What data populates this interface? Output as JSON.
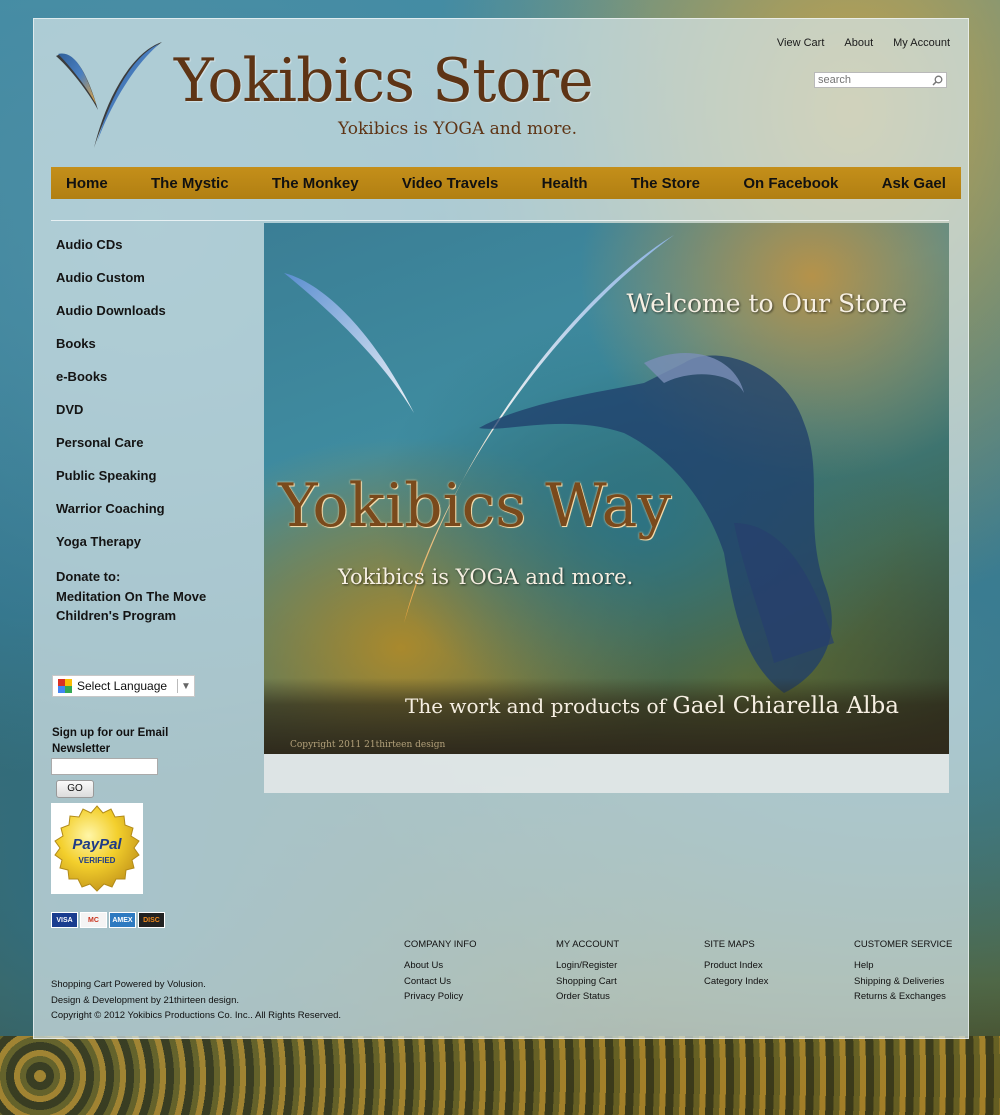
{
  "header": {
    "title": "Yokibics Store",
    "tagline": "Yokibics is YOGA and more.",
    "util_links": [
      "View Cart",
      "About",
      "My Account"
    ],
    "search_placeholder": "search"
  },
  "nav": [
    "Home",
    "The Mystic",
    "The Monkey",
    "Video Travels",
    "Health",
    "The Store",
    "On Facebook",
    "Ask Gael"
  ],
  "sidebar": {
    "categories": [
      "Audio CDs",
      "Audio Custom",
      "Audio Downloads",
      "Books",
      "e-Books",
      "DVD",
      "Personal Care",
      "Public Speaking",
      "Warrior Coaching",
      "Yoga Therapy"
    ],
    "donate_lines": [
      "Donate to:",
      "Meditation On The Move",
      "Children's Program"
    ],
    "language_label": "Select Language",
    "newsletter_label": "Sign up for our Email Newsletter",
    "go_label": "GO",
    "paypal_text": "PayPal",
    "paypal_verified": "VERIFIED",
    "cards": [
      "VISA",
      "MC",
      "AMEX",
      "DISC"
    ]
  },
  "hero": {
    "welcome": "Welcome to Our Store",
    "title": "Yokibics Way",
    "subtitle": "Yokibics is YOGA and more.",
    "work_prefix": "The work and products of",
    "work_name": "Gael Chiarella Alba",
    "copyright": "Copyright 2011 21thirteen design"
  },
  "footer": {
    "left_lines": [
      "Shopping Cart Powered by Volusion.",
      "Design & Development by 21thirteen design.",
      "Copyright © 2012 Yokibics Productions Co. Inc.. All Rights Reserved."
    ],
    "columns": [
      {
        "heading": "COMPANY INFO",
        "links": [
          "About Us",
          "Contact Us",
          "Privacy Policy"
        ]
      },
      {
        "heading": "MY ACCOUNT",
        "links": [
          "Login/Register",
          "Shopping Cart",
          "Order Status"
        ]
      },
      {
        "heading": "SITE MAPS",
        "links": [
          "Product Index",
          "Category Index"
        ]
      },
      {
        "heading": "CUSTOMER SERVICE",
        "links": [
          "Help",
          "Shipping & Deliveries",
          "Returns & Exchanges"
        ]
      }
    ]
  },
  "colors": {
    "nav_bar": "#c48f1a",
    "title_brown": "#5e3415",
    "panel": "#d6e5e8"
  }
}
